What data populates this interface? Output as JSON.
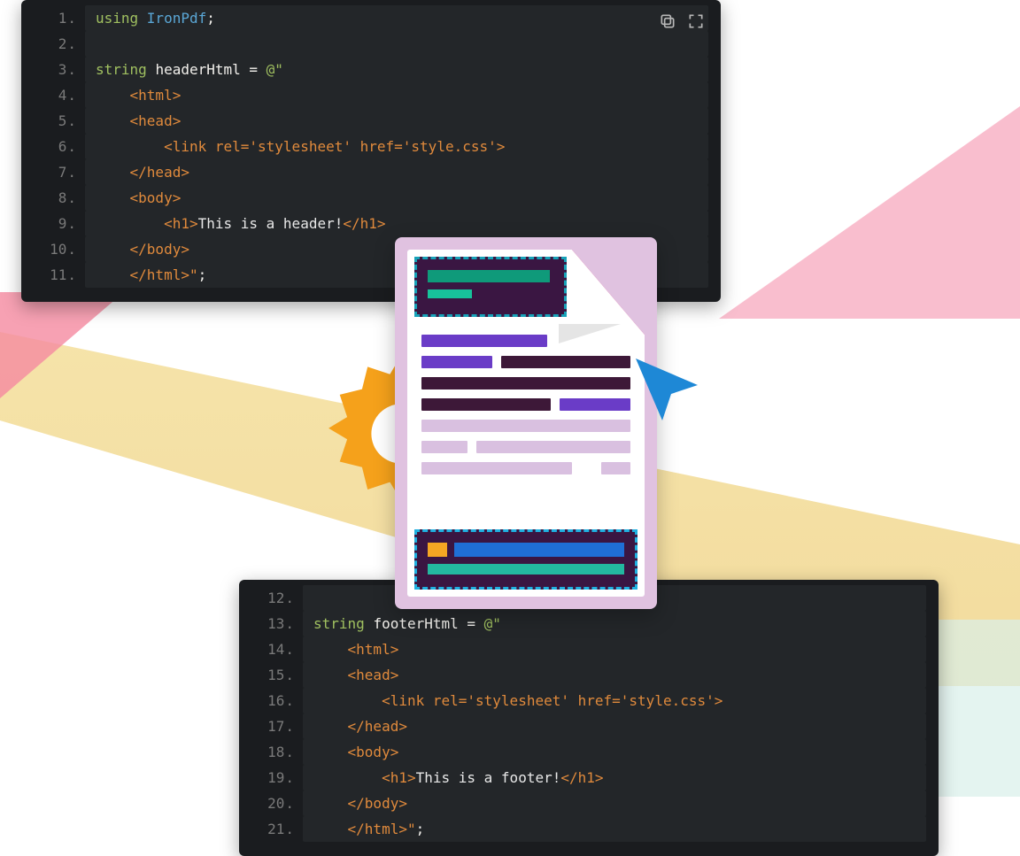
{
  "code1": {
    "lines": [
      {
        "n": "1",
        "tokens": [
          {
            "t": "using ",
            "c": "k"
          },
          {
            "t": "IronPdf",
            "c": "ty"
          },
          {
            "t": ";",
            "c": "op"
          }
        ]
      },
      {
        "n": "2",
        "tokens": [
          {
            "t": "",
            "c": "id"
          }
        ]
      },
      {
        "n": "3",
        "tokens": [
          {
            "t": "string ",
            "c": "k"
          },
          {
            "t": "headerHtml ",
            "c": "id"
          },
          {
            "t": "= ",
            "c": "op"
          },
          {
            "t": "@\"",
            "c": "at"
          }
        ]
      },
      {
        "n": "4",
        "tokens": [
          {
            "t": "    <html>",
            "c": "t"
          }
        ]
      },
      {
        "n": "5",
        "tokens": [
          {
            "t": "    <head>",
            "c": "t"
          }
        ]
      },
      {
        "n": "6",
        "tokens": [
          {
            "t": "        <link rel='stylesheet' href='style.css'>",
            "c": "t"
          }
        ]
      },
      {
        "n": "7",
        "tokens": [
          {
            "t": "    </head>",
            "c": "t"
          }
        ]
      },
      {
        "n": "8",
        "tokens": [
          {
            "t": "    <body>",
            "c": "t"
          }
        ]
      },
      {
        "n": "9",
        "tokens": [
          {
            "t": "        <h1>",
            "c": "t"
          },
          {
            "t": "This is a header!",
            "c": "ht"
          },
          {
            "t": "</h1>",
            "c": "t"
          }
        ]
      },
      {
        "n": "10",
        "tokens": [
          {
            "t": "    </body>",
            "c": "t"
          }
        ]
      },
      {
        "n": "11",
        "tokens": [
          {
            "t": "    </html>\"",
            "c": "t"
          },
          {
            "t": ";",
            "c": "op"
          }
        ]
      }
    ]
  },
  "code2": {
    "lines": [
      {
        "n": "12",
        "tokens": [
          {
            "t": "",
            "c": "id"
          }
        ]
      },
      {
        "n": "13",
        "tokens": [
          {
            "t": "string ",
            "c": "k"
          },
          {
            "t": "footerHtml ",
            "c": "id"
          },
          {
            "t": "= ",
            "c": "op"
          },
          {
            "t": "@\"",
            "c": "at"
          }
        ]
      },
      {
        "n": "14",
        "tokens": [
          {
            "t": "    <html>",
            "c": "t"
          }
        ]
      },
      {
        "n": "15",
        "tokens": [
          {
            "t": "    <head>",
            "c": "t"
          }
        ]
      },
      {
        "n": "16",
        "tokens": [
          {
            "t": "        <link rel='stylesheet' href='style.css'>",
            "c": "t"
          }
        ]
      },
      {
        "n": "17",
        "tokens": [
          {
            "t": "    </head>",
            "c": "t"
          }
        ]
      },
      {
        "n": "18",
        "tokens": [
          {
            "t": "    <body>",
            "c": "t"
          }
        ]
      },
      {
        "n": "19",
        "tokens": [
          {
            "t": "        <h1>",
            "c": "t"
          },
          {
            "t": "This is a footer!",
            "c": "ht"
          },
          {
            "t": "</h1>",
            "c": "t"
          }
        ]
      },
      {
        "n": "20",
        "tokens": [
          {
            "t": "    </body>",
            "c": "t"
          }
        ]
      },
      {
        "n": "21",
        "tokens": [
          {
            "t": "    </html>\"",
            "c": "t"
          },
          {
            "t": ";",
            "c": "op"
          }
        ]
      }
    ]
  }
}
